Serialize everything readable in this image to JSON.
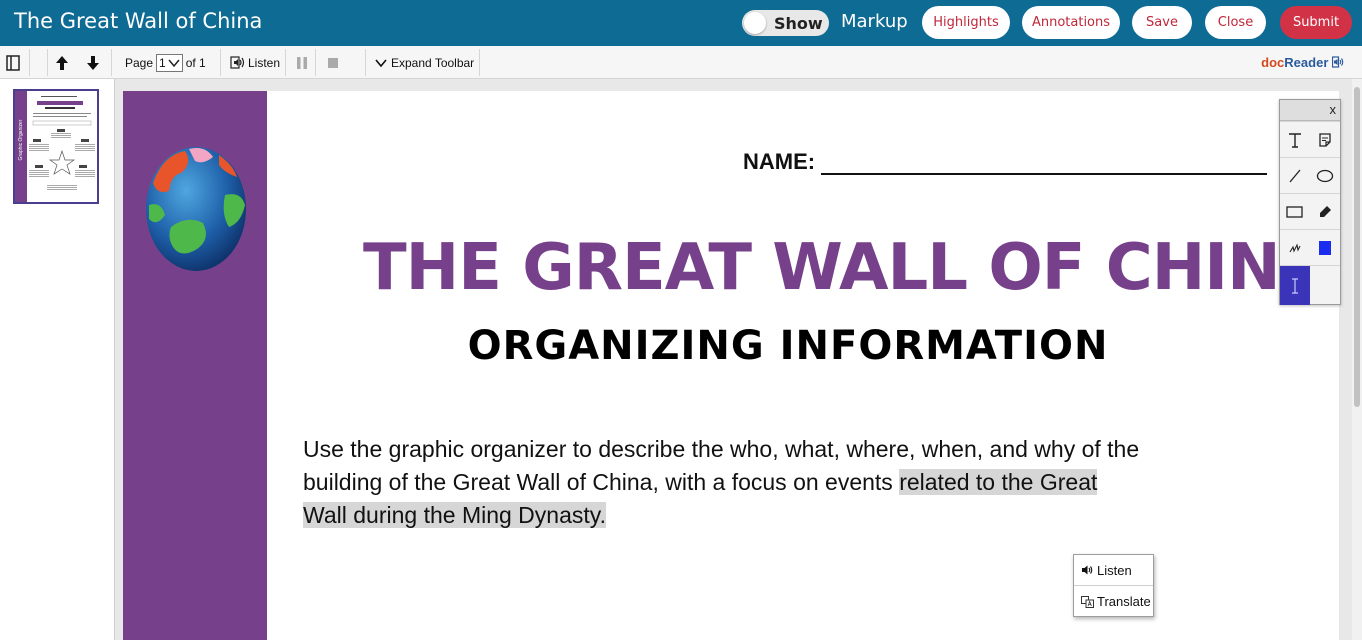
{
  "header": {
    "title": "The Great Wall of China",
    "toggle_label": "Show",
    "markup_label": "Markup",
    "buttons": {
      "highlights": "Highlights",
      "annotations": "Annotations",
      "save": "Save",
      "close": "Close",
      "submit": "Submit"
    }
  },
  "toolbar": {
    "page_label": "Page",
    "page_value": "1",
    "page_of": "of 1",
    "listen_label": "Listen",
    "expand_label": "Expand Toolbar",
    "brand_doc": "doc",
    "brand_reader": "Reader"
  },
  "thumbnail": {
    "side_text": "Graphic Organizer"
  },
  "document": {
    "name_label": "NAME:",
    "title": "THE GREAT WALL OF CHINA",
    "subtitle": "ORGANIZING INFORMATION",
    "body_plain_1": "Use the graphic organizer to describe the who, what, where, when, and why of the building of the Great Wall of China, with a focus on events ",
    "body_highlighted": "related to the Great Wall during the Ming Dynasty.",
    "accent_color": "#76418a"
  },
  "palette": {
    "close_label": "x",
    "tools": [
      "text-tool-icon",
      "sticky-note-icon",
      "line-icon",
      "ellipse-icon",
      "rectangle-icon",
      "highlighter-icon",
      "freehand-icon",
      "color-swatch-icon",
      "text-cursor-icon"
    ]
  },
  "context_menu": {
    "listen": "Listen",
    "translate": "Translate"
  },
  "colors": {
    "header_bg": "#0e6b94",
    "submit_bg": "#d23246",
    "highlight_bg": "#d6d6d6",
    "palette_active": "#3a35b8"
  }
}
